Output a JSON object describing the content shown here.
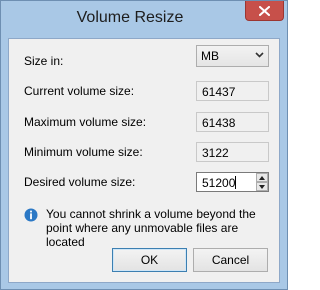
{
  "window": {
    "title": "Volume Resize"
  },
  "icons": {
    "close": "close-icon",
    "chevron": "chevron-down-icon",
    "info": "info-icon"
  },
  "colors": {
    "close_bg": "#c7504a",
    "frame": "#a9c8e6",
    "info_blue": "#2b78c5"
  },
  "form": {
    "size_in": {
      "label": "Size in:",
      "value": "MB"
    },
    "current": {
      "label": "Current volume size:",
      "value": "61437"
    },
    "maximum": {
      "label": "Maximum volume size:",
      "value": "61438"
    },
    "minimum": {
      "label": "Minimum volume size:",
      "value": "3122"
    },
    "desired": {
      "label": "Desired volume size:",
      "value": "51200"
    }
  },
  "info": {
    "text": "You cannot shrink a volume beyond the point where any unmovable files are located"
  },
  "buttons": {
    "ok": "OK",
    "cancel": "Cancel"
  }
}
